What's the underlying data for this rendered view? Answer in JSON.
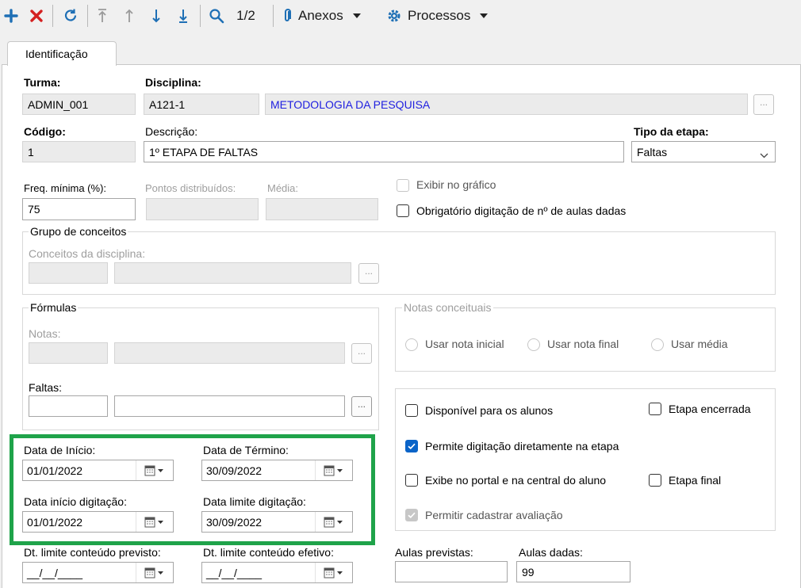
{
  "toolbar": {
    "page_indicator": "1/2",
    "anexos_label": "Anexos",
    "processos_label": "Processos"
  },
  "tab": {
    "label": "Identificação"
  },
  "form": {
    "turma": {
      "label": "Turma:",
      "value": "ADMIN_001"
    },
    "disciplina": {
      "label": "Disciplina:",
      "code": "A121-1",
      "name": "METODOLOGIA DA PESQUISA"
    },
    "codigo": {
      "label": "Código:",
      "value": "1"
    },
    "descricao": {
      "label": "Descrição:",
      "value": "1º ETAPA DE FALTAS"
    },
    "tipo_etapa": {
      "label": "Tipo da etapa:",
      "value": "Faltas"
    },
    "freq_minima": {
      "label": "Freq. mínima (%):",
      "value": "75"
    },
    "pontos_distribuidos": {
      "label": "Pontos distribuídos:"
    },
    "media": {
      "label": "Média:"
    },
    "exibir_grafico": {
      "label": "Exibir no gráfico",
      "checked": false,
      "enabled": false
    },
    "obrigatorio_aulas": {
      "label": "Obrigatório digitação de nº de aulas dadas",
      "checked": false
    },
    "grupo_conceitos": {
      "legend": "Grupo de conceitos",
      "conceitos_label": "Conceitos da disciplina:"
    },
    "formulas": {
      "legend": "Fórmulas",
      "notas_label": "Notas:",
      "faltas_label": "Faltas:"
    },
    "notas_conceituais": {
      "legend": "Notas conceituais",
      "options": [
        "Usar nota inicial",
        "Usar nota final",
        "Usar média"
      ]
    },
    "disponivel_alunos": {
      "label": "Disponível para os alunos",
      "checked": false
    },
    "etapa_encerrada": {
      "label": "Etapa encerrada",
      "checked": false
    },
    "permite_digitacao": {
      "label": "Permite digitação diretamente na etapa",
      "checked": true
    },
    "exibe_portal": {
      "label": "Exibe no portal e na central do aluno",
      "checked": false
    },
    "etapa_final": {
      "label": "Etapa final",
      "checked": false
    },
    "permitir_avaliacao": {
      "label": "Permitir cadastrar avaliação",
      "checked": true,
      "enabled": false
    },
    "data_inicio": {
      "label": "Data de Início:",
      "value": "01/01/2022"
    },
    "data_termino": {
      "label": "Data de Término:",
      "value": "30/09/2022"
    },
    "data_inicio_digitacao": {
      "label": "Data início digitação:",
      "value": "01/01/2022"
    },
    "data_limite_digitacao": {
      "label": "Data limite digitação:",
      "value": "30/09/2022"
    },
    "dt_limite_previsto": {
      "label": "Dt. limite conteúdo previsto:",
      "value": "__/__/____"
    },
    "dt_limite_efetivo": {
      "label": "Dt. limite conteúdo efetivo:",
      "value": "__/__/____"
    },
    "aulas_previstas": {
      "label": "Aulas previstas:",
      "value": ""
    },
    "aulas_dadas": {
      "label": "Aulas dadas:",
      "value": "99"
    }
  },
  "colors": {
    "highlight": "#1fa34a",
    "link_blue": "#2020e0",
    "check_blue": "#0a64c8"
  }
}
